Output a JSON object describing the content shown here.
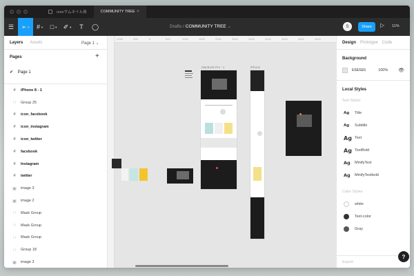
{
  "os_tabs": [
    {
      "label": "noteサムネイル用"
    },
    {
      "label": "COMMUNITY TREE",
      "close": "×"
    }
  ],
  "toolbar": {
    "breadcrumb_parent": "Drafts",
    "breadcrumb_sep": "/",
    "file_name": "COMMUNITY TREE",
    "file_caret": "⌄",
    "share_label": "Share",
    "zoom": "11%",
    "avatar_initial": "S"
  },
  "left_panel": {
    "tabs": {
      "layers": "Layers",
      "assets": "Assets"
    },
    "current_page": "Page 1 ⌄",
    "pages_title": "Pages",
    "pages_add": "+",
    "page_items": [
      {
        "check": "✔",
        "label": "Page 1"
      }
    ],
    "layers": [
      {
        "icon": "#",
        "label": "iPhone 8 - 1",
        "top": true
      },
      {
        "icon": "∷",
        "label": "Group 25"
      },
      {
        "icon": "#",
        "label": "icon_facebook"
      },
      {
        "icon": "#",
        "label": "icon_instagram"
      },
      {
        "icon": "#",
        "label": "icon_twitter"
      },
      {
        "icon": "#",
        "label": "facebook"
      },
      {
        "icon": "#",
        "label": "Instagram"
      },
      {
        "icon": "#",
        "label": "twitter"
      },
      {
        "icon": "▣",
        "label": "image 3"
      },
      {
        "icon": "▣",
        "label": "image 2"
      },
      {
        "icon": "∷",
        "label": "Mask Group"
      },
      {
        "icon": "∷",
        "label": "Mask Group"
      },
      {
        "icon": "∷",
        "label": "Mask Group"
      },
      {
        "icon": "∷",
        "label": "Group 18"
      },
      {
        "icon": "▣",
        "label": "image 3"
      }
    ]
  },
  "canvas": {
    "frame_labels": {
      "macbook": "MacBook Pro - 1",
      "iphone": "iPhone"
    },
    "ruler_ticks": [
      "-1000",
      "-500",
      "0",
      "500",
      "1000",
      "1500",
      "2000",
      "2500",
      "3000",
      "3500",
      "4000",
      "4500",
      "5000"
    ]
  },
  "right_panel": {
    "tabs": {
      "design": "Design",
      "prototype": "Prototype",
      "code": "Code"
    },
    "background_title": "Background",
    "background_hex": "E5E5E5",
    "background_opacity": "100%",
    "local_styles_title": "Local Styles",
    "text_styles_title": "Text Styles",
    "text_styles": [
      {
        "glyph": "Ag",
        "label": "Title"
      },
      {
        "glyph": "Ag",
        "label": "Subtitle"
      },
      {
        "glyph": "Ag",
        "label": "Text"
      },
      {
        "glyph": "Ag",
        "label": "TextBold"
      },
      {
        "glyph": "Ag",
        "label": "MinifyText"
      },
      {
        "glyph": "Ag",
        "label": "MinifyTextbold"
      }
    ],
    "color_styles_title": "Color Styles",
    "color_styles": [
      {
        "label": "white",
        "color": "#ffffff"
      },
      {
        "label": "Text-color",
        "color": "#333333"
      },
      {
        "label": "Gray",
        "color": "#555555"
      }
    ],
    "export_label": "Export",
    "help_label": "?"
  },
  "colors": {
    "accent": "#18a0fb",
    "chrome": "#2c2c2c",
    "canvas": "#e5e5e5"
  }
}
